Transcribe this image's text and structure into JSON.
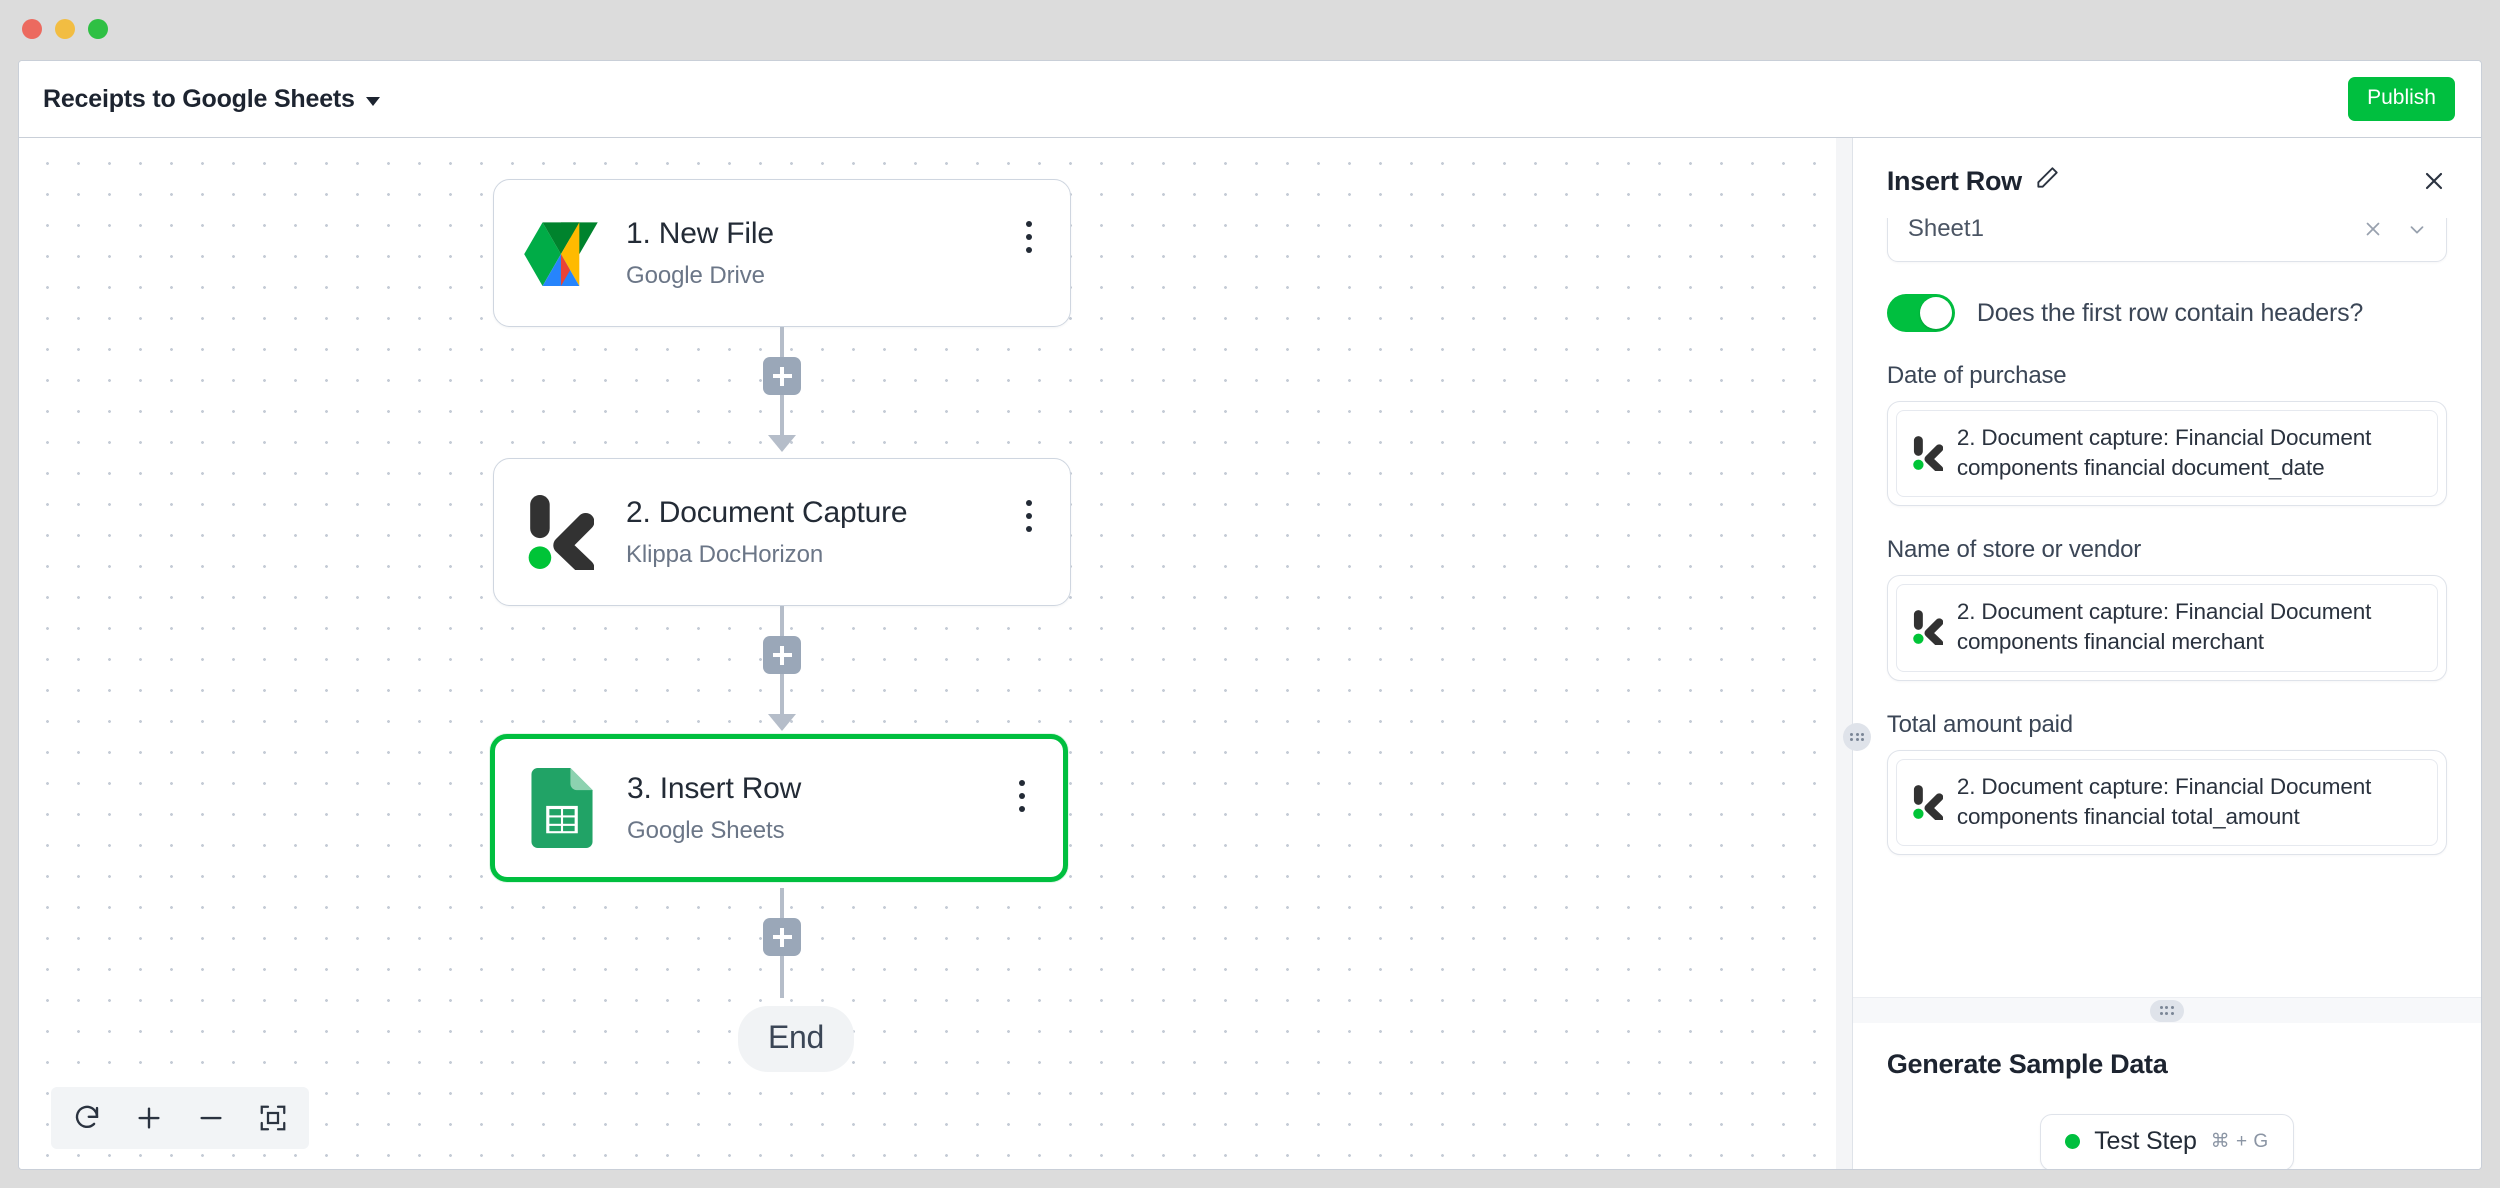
{
  "window": {
    "traffic_lights": [
      "close",
      "minimize",
      "maximize"
    ]
  },
  "header": {
    "flow_title": "Receipts to Google Sheets",
    "caret_icon": "chevron-down-icon",
    "publish_label": "Publish"
  },
  "canvas": {
    "nodes": [
      {
        "title": "1. New File",
        "subtitle": "Google Drive",
        "icon": "google-drive-icon",
        "selected": false
      },
      {
        "title": "2. Document Capture",
        "subtitle": "Klippa DocHorizon",
        "icon": "klippa-dochorizon-icon",
        "selected": false
      },
      {
        "title": "3. Insert Row",
        "subtitle": "Google Sheets",
        "icon": "google-sheets-icon",
        "selected": true
      }
    ],
    "end_label": "End",
    "add_step_label": "+",
    "toolbar": [
      {
        "name": "reset-view-button",
        "icon": "refresh-icon"
      },
      {
        "name": "zoom-in-button",
        "icon": "plus-icon"
      },
      {
        "name": "zoom-out-button",
        "icon": "minus-icon"
      },
      {
        "name": "fit-view-button",
        "icon": "fit-screen-icon"
      }
    ]
  },
  "panel": {
    "title": "Insert Row",
    "edit_icon": "pencil-icon",
    "close_icon": "close-icon",
    "sheet_select": {
      "value": "Sheet1",
      "clear_icon": "clear-icon",
      "chevron_icon": "chevron-down-icon"
    },
    "headers_toggle": {
      "label": "Does the first row contain headers?",
      "enabled": true
    },
    "fields": [
      {
        "label": "Date of purchase",
        "token": "2. Document capture: Financial Document components financial document_date",
        "token_icon": "klippa-dochorizon-icon"
      },
      {
        "label": "Name of store or vendor",
        "token": "2. Document capture: Financial Document components financial merchant",
        "token_icon": "klippa-dochorizon-icon"
      },
      {
        "label": "Total amount paid",
        "token": "2. Document capture: Financial Document components financial total_amount",
        "token_icon": "klippa-dochorizon-icon"
      }
    ],
    "splitter_icon": "drag-handle-icon",
    "sample_data": {
      "title": "Generate Sample Data",
      "test_step_label": "Test Step",
      "test_step_shortcut": "⌘ + G",
      "status_color": "#00bf3f"
    }
  },
  "colors": {
    "accent_green": "#00bf3f",
    "border": "#cfd6e0",
    "text_primary": "#232b36",
    "text_secondary": "#6b7687"
  }
}
